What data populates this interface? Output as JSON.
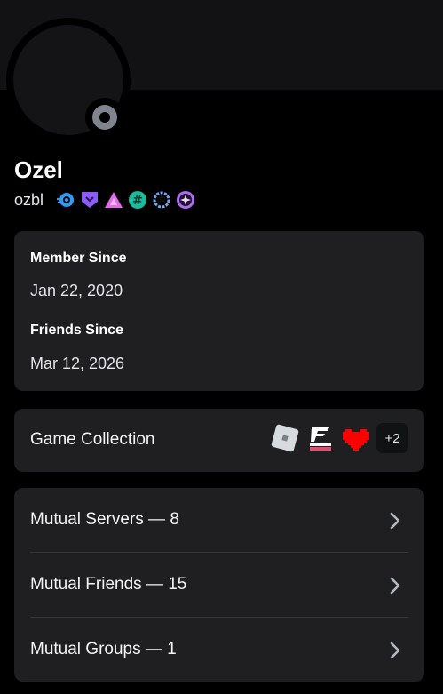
{
  "profile": {
    "display_name": "Ozel",
    "username": "ozbl",
    "status": "offline",
    "badges": [
      {
        "icon": "nitro-badge-icon",
        "color": "#2f9cf6"
      },
      {
        "icon": "shield-badge-icon",
        "color": "#8a5cf5"
      },
      {
        "icon": "triangle-badge-icon",
        "color": "#e06ce8"
      },
      {
        "icon": "hashtag-badge-icon",
        "color": "#1abc9c"
      },
      {
        "icon": "laurel-badge-icon",
        "color": "#6fa8f5"
      },
      {
        "icon": "sparkle-badge-icon",
        "color": "#b06cf0"
      }
    ]
  },
  "dates": {
    "member_since_label": "Member Since",
    "member_since_value": "Jan 22, 2020",
    "friends_since_label": "Friends Since",
    "friends_since_value": "Mar 12, 2026"
  },
  "games": {
    "title": "Game Collection",
    "icons": [
      "roblox-icon",
      "forza-horizon-icon",
      "pixel-heart-icon"
    ],
    "more": "+2"
  },
  "mutuals": [
    {
      "label": "Mutual Servers — 8"
    },
    {
      "label": "Mutual Friends — 15"
    },
    {
      "label": "Mutual Groups — 1"
    }
  ],
  "colors": {
    "background": "#000000",
    "card": "#1f1f22",
    "status_offline": "#80848e"
  }
}
